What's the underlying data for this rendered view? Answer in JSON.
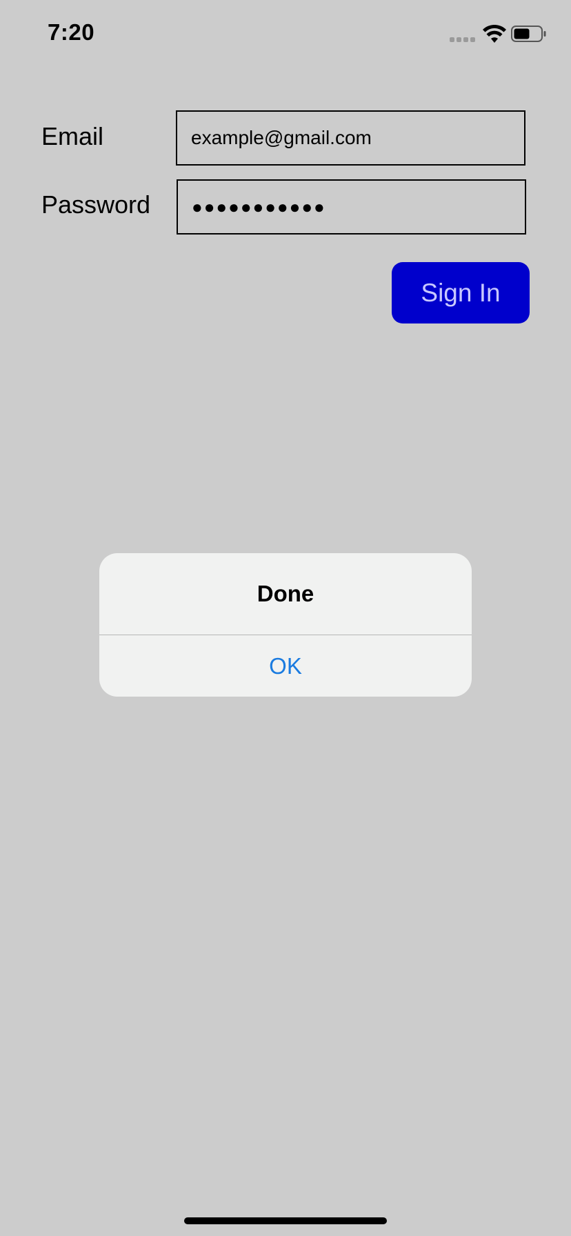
{
  "status_bar": {
    "time": "7:20",
    "signal_icon": "cellular-signal-icon",
    "wifi_icon": "wifi-icon",
    "battery_icon": "battery-icon",
    "battery_level": 0.5
  },
  "form": {
    "email_label": "Email",
    "email_value": "example@gmail.com",
    "password_label": "Password",
    "password_value": "●●●●●●●●●●●",
    "sign_in_label": "Sign In"
  },
  "alert": {
    "title": "Done",
    "ok_label": "OK"
  },
  "colors": {
    "background": "#cccccc",
    "button": "#0000cc",
    "button_text": "#c8c8ff",
    "alert_action": "#1a7be0"
  }
}
